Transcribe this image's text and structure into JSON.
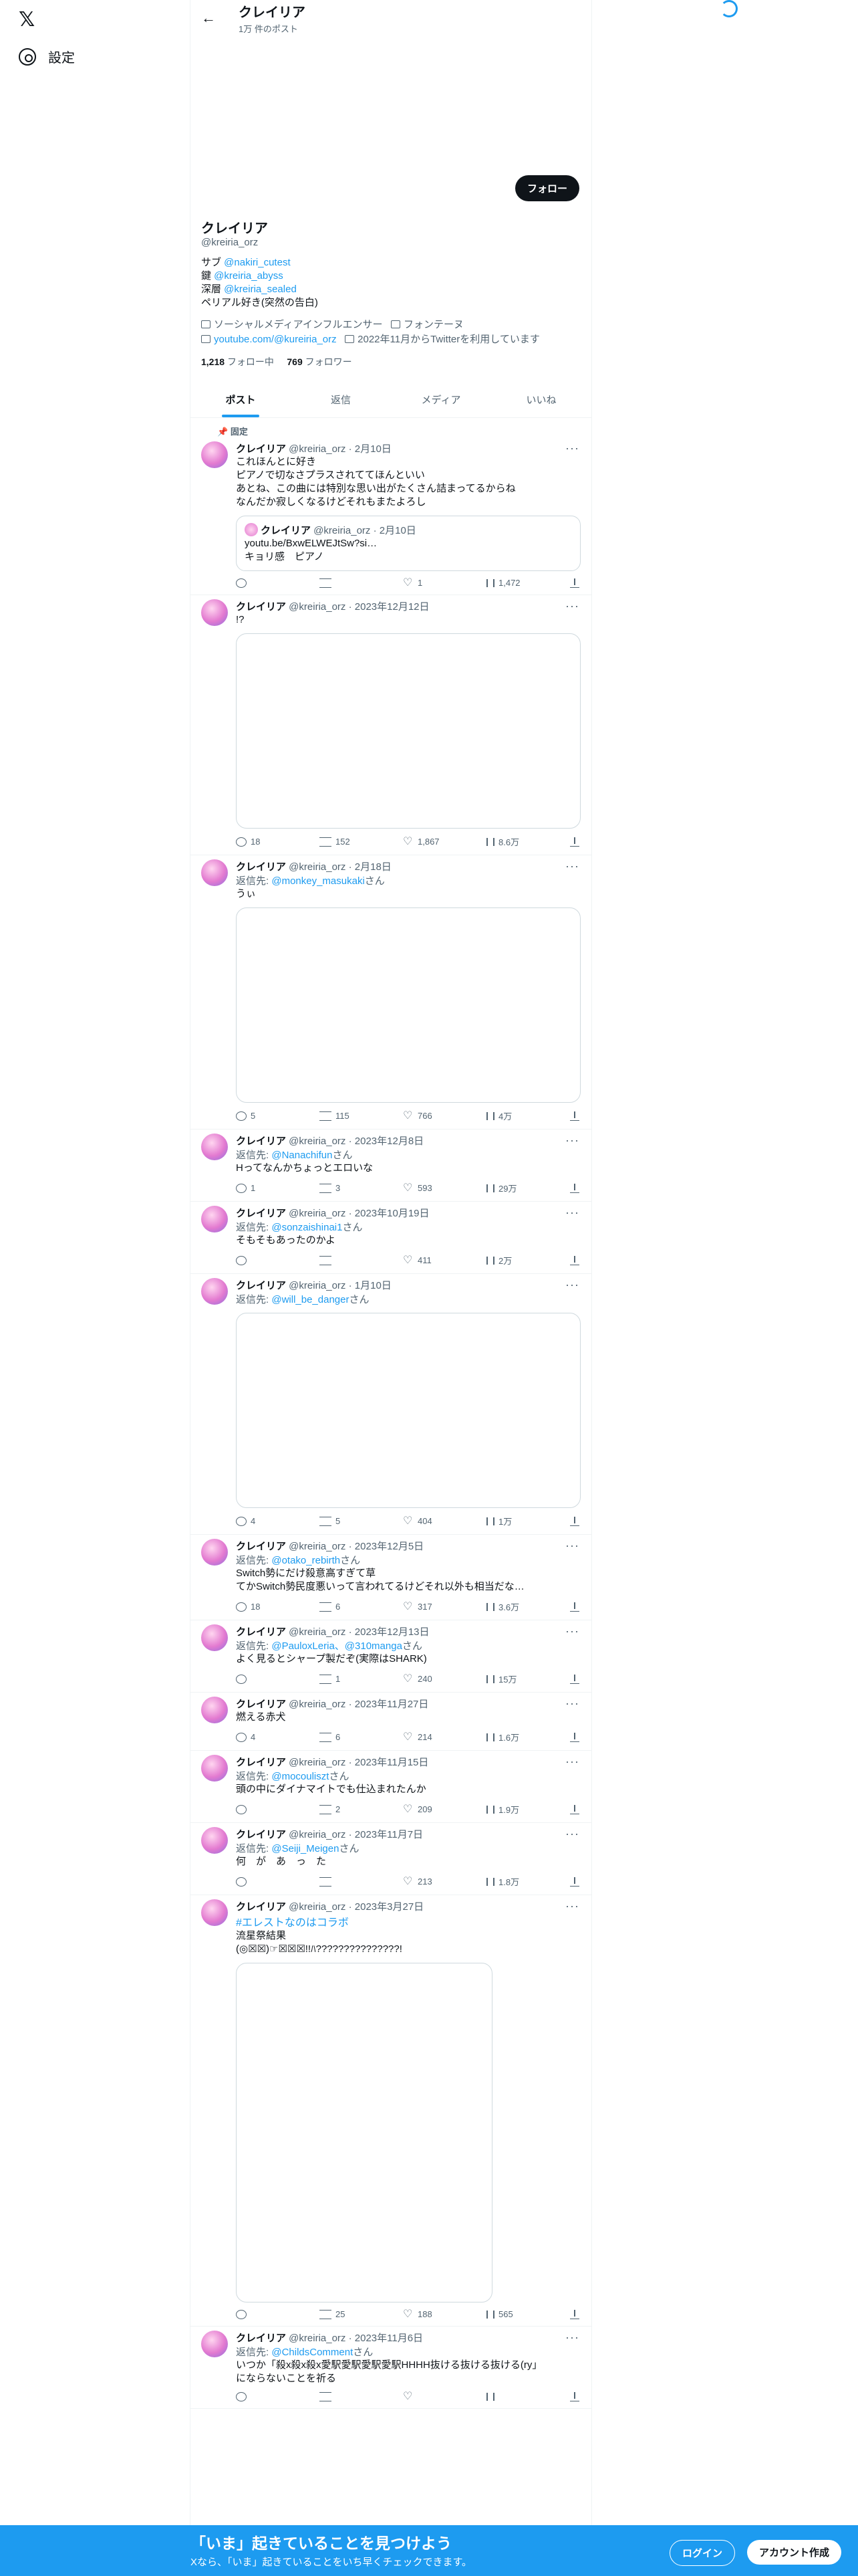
{
  "nav": {
    "logo": "𝕏",
    "settings": "設定"
  },
  "top": {
    "name": "クレイリア",
    "count": "1万 件のポスト"
  },
  "profile": {
    "follow_label": "フォロー",
    "name": "クレイリア",
    "handle": "@kreiria_orz",
    "bio": [
      {
        "prefix": "サブ ",
        "link": "@nakiri_cutest"
      },
      {
        "prefix": "鍵 ",
        "link": "@kreiria_abyss"
      },
      {
        "prefix": "深層 ",
        "link": "@kreiria_sealed"
      },
      {
        "prefix": "ペリアル好き(突然の告白)",
        "link": ""
      }
    ],
    "category": "ソーシャルメディアインフルエンサー",
    "location": "フォンテーヌ",
    "website": "youtube.com/@kureiria_orz",
    "joined": "2022年11月からTwitterを利用しています",
    "following_count": "1,218",
    "following_label": "フォロー中",
    "followers_count": "769",
    "followers_label": "フォロワー"
  },
  "tabs": [
    "ポスト",
    "返信",
    "メディア",
    "いいね"
  ],
  "pinned_label": "固定",
  "tweets": [
    {
      "name": "クレイリア",
      "handle": "@kreiria_orz",
      "date": "2月10日",
      "reply_to": "",
      "text": "これほんとに好き\nピアノで切なさプラスされててほんといい\nあとね、この曲には特別な思い出がたくさん詰まってるからね\nなんだか寂しくなるけどそれもまたよろし",
      "quote": {
        "name": "クレイリア",
        "handle": "@kreiria_orz",
        "date": "2月10日",
        "text": "youtu.be/BxwELWEJtSw?si…\nキョリ感　ピアノ"
      },
      "media_h": 0,
      "replies": "",
      "retweets": "",
      "likes": "1",
      "views": "1,472"
    },
    {
      "name": "クレイリア",
      "handle": "@kreiria_orz",
      "date": "2023年12月12日",
      "reply_to": "",
      "text": "!?",
      "media_h": 292,
      "replies": "18",
      "retweets": "152",
      "likes": "1,867",
      "views": "8.6万"
    },
    {
      "name": "クレイリア",
      "handle": "@kreiria_orz",
      "date": "2月18日",
      "reply_to": "@monkey_masukaki",
      "text": "うぃ",
      "media_h": 292,
      "replies": "5",
      "retweets": "115",
      "likes": "766",
      "views": "4万"
    },
    {
      "name": "クレイリア",
      "handle": "@kreiria_orz",
      "date": "2023年12月8日",
      "reply_to": "@Nanachifun",
      "text": "Hってなんかちょっとエロいな",
      "media_h": 0,
      "replies": "1",
      "retweets": "3",
      "likes": "593",
      "views": "29万"
    },
    {
      "name": "クレイリア",
      "handle": "@kreiria_orz",
      "date": "2023年10月19日",
      "reply_to": "@sonzaishinai1",
      "text": "そもそもあったのかよ",
      "media_h": 0,
      "replies": "",
      "retweets": "",
      "likes": "411",
      "views": "2万"
    },
    {
      "name": "クレイリア",
      "handle": "@kreiria_orz",
      "date": "1月10日",
      "reply_to": "@will_be_danger",
      "text": "",
      "media_h": 292,
      "replies": "4",
      "retweets": "5",
      "likes": "404",
      "views": "1万"
    },
    {
      "name": "クレイリア",
      "handle": "@kreiria_orz",
      "date": "2023年12月5日",
      "reply_to": "@otako_rebirth",
      "text": "Switch勢にだけ殺意高すぎて草\nてかSwitch勢民度悪いって言われてるけどそれ以外も相当だな…",
      "media_h": 0,
      "replies": "18",
      "retweets": "6",
      "likes": "317",
      "views": "3.6万"
    },
    {
      "name": "クレイリア",
      "handle": "@kreiria_orz",
      "date": "2023年12月13日",
      "reply_to": "@PauloxLeria、@310manga",
      "text": "よく見るとシャープ製だぞ(実際はSHARK)",
      "media_h": 0,
      "replies": "",
      "retweets": "1",
      "likes": "240",
      "views": "15万"
    },
    {
      "name": "クレイリア",
      "handle": "@kreiria_orz",
      "date": "2023年11月27日",
      "reply_to": "",
      "text": "燃える赤犬",
      "media_h": 0,
      "replies": "4",
      "retweets": "6",
      "likes": "214",
      "views": "1.6万"
    },
    {
      "name": "クレイリア",
      "handle": "@kreiria_orz",
      "date": "2023年11月15日",
      "reply_to": "@mocouliszt",
      "text": "頭の中にダイナマイトでも仕込まれたんか",
      "media_h": 0,
      "replies": "",
      "retweets": "2",
      "likes": "209",
      "views": "1.9万"
    },
    {
      "name": "クレイリア",
      "handle": "@kreiria_orz",
      "date": "2023年11月7日",
      "reply_to": "@Seiji_Meigen",
      "text": "何　が　あ　っ　た",
      "media_h": 0,
      "replies": "",
      "retweets": "",
      "likes": "213",
      "views": "1.8万"
    },
    {
      "name": "クレイリア",
      "handle": "@kreiria_orz",
      "date": "2023年3月27日",
      "reply_to": "",
      "hashtag": "#エレストなのはコラボ",
      "text": "流星祭結果\n(◎☒☒)☞☒☒☒!!ﾊ???????????????!",
      "media_h": 508,
      "media_w": 384,
      "replies": "",
      "retweets": "25",
      "likes": "188",
      "views": "565"
    },
    {
      "name": "クレイリア",
      "handle": "@kreiria_orz",
      "date": "2023年11月6日",
      "reply_to": "@ChildsComment",
      "text": "いつか「殺x殺x殺x愛駅愛駅愛駅愛駅HHHH抜ける抜ける抜ける(ry」\nにならないことを祈る",
      "media_h": 0,
      "replies": "",
      "retweets": "",
      "likes": "",
      "views": ""
    }
  ],
  "bottom": {
    "headline": "「いま」起きていることを見つけよう",
    "sub": "Xなら、「いま」起きていることをいち早くチェックできます。",
    "login": "ログイン",
    "signup": "アカウント作成"
  }
}
